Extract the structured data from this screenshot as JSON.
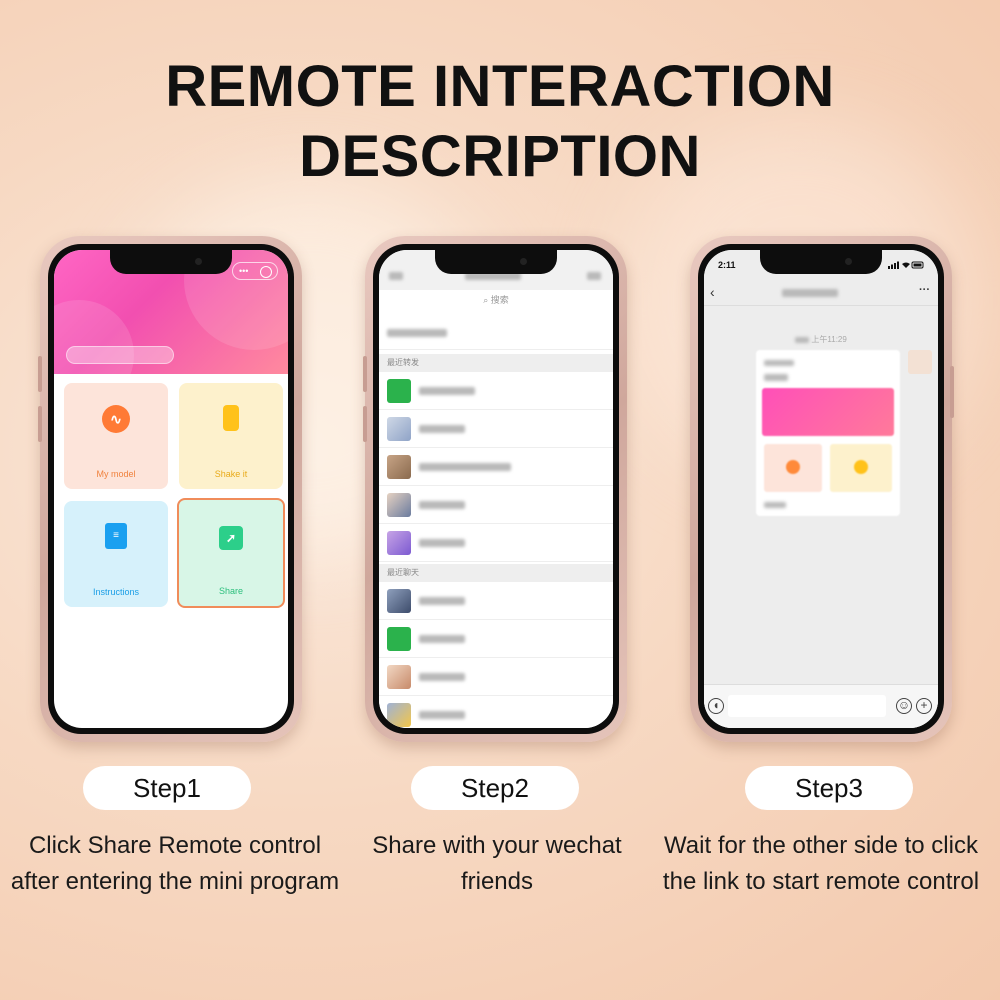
{
  "title": {
    "line1": "REMOTE INTERACTION",
    "line2": "DESCRIPTION"
  },
  "phone1": {
    "tiles": [
      {
        "label": "My model",
        "icon": "heartbeat-icon"
      },
      {
        "label": "Shake it",
        "icon": "vibrate-icon"
      },
      {
        "label": "Instructions",
        "icon": "book-icon"
      },
      {
        "label": "Share",
        "icon": "share-icon"
      }
    ]
  },
  "phone2": {
    "search_placeholder": "搜索",
    "section_recent_forward": "最近转发",
    "section_recent_chats": "最近聊天"
  },
  "phone3": {
    "status_time": "2:11",
    "chat_time": "上午11:29"
  },
  "steps": [
    {
      "label": "Step1",
      "description": "Click Share Remote control after entering the mini program"
    },
    {
      "label": "Step2",
      "description": "Share with your wechat friends"
    },
    {
      "label": "Step3",
      "description": "Wait for the other side to click the link to start remote control"
    }
  ]
}
